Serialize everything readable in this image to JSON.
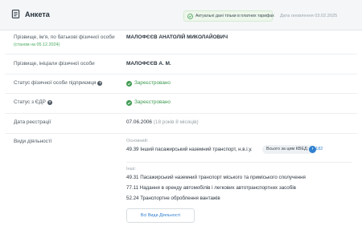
{
  "header": {
    "title": "Анкета",
    "notice": "Актуальні дані тільки в платних тарифах",
    "update_date": "Дата оновлення 03.02.2025"
  },
  "rows": {
    "full_name": {
      "label": "Прізвище, ім'я, по батькові фізичної особи",
      "sublabel": "(станом на 05.12.2024)",
      "value": "МАЛОФЄЄВ АНАТОЛІЙ МИКОЛАЙОВИЧ"
    },
    "short_name": {
      "label": "Прізвище, ініціали фізичної особи",
      "value": "МАЛОФЄЄВ А. М."
    },
    "fop_status": {
      "label": "Статус фізичної особи підприємця",
      "value": "Зареєстровано"
    },
    "edr_status": {
      "label": "Статус з ЄДР",
      "value": "Зареєстровано"
    },
    "reg_date": {
      "label": "Дата реєстрації",
      "value": "07.06.2006",
      "note": "(18 років 8 місяців)"
    },
    "activities": {
      "label": "Види діяльності",
      "main_label": "Основний:",
      "main_value": "49.39 Інший пасажирський наземний транспорт, н.в.і.у.",
      "total_label": "Всього за цим КВЕД:",
      "total_count": "10 182",
      "other_label": "Інші:",
      "other_items": [
        "49.31 Пасажирський наземний транспорт міського та приміського сполучення",
        "77.11 Надання в оренду автомобілів і легкових автотранспортних засобів",
        "52.24 Транспортне оброблення вантажів"
      ],
      "all_button": "Всі Види Діяльності"
    }
  },
  "colors": {
    "accent": "#2e7fcf",
    "success": "#3d9a50",
    "header_bg": "#f4f6f8"
  },
  "icons": {
    "header": "document-icon",
    "notice": "check-circle-icon",
    "status": "check-circle-icon",
    "help": "question-icon",
    "total_arrow": "chevron-right-icon"
  }
}
